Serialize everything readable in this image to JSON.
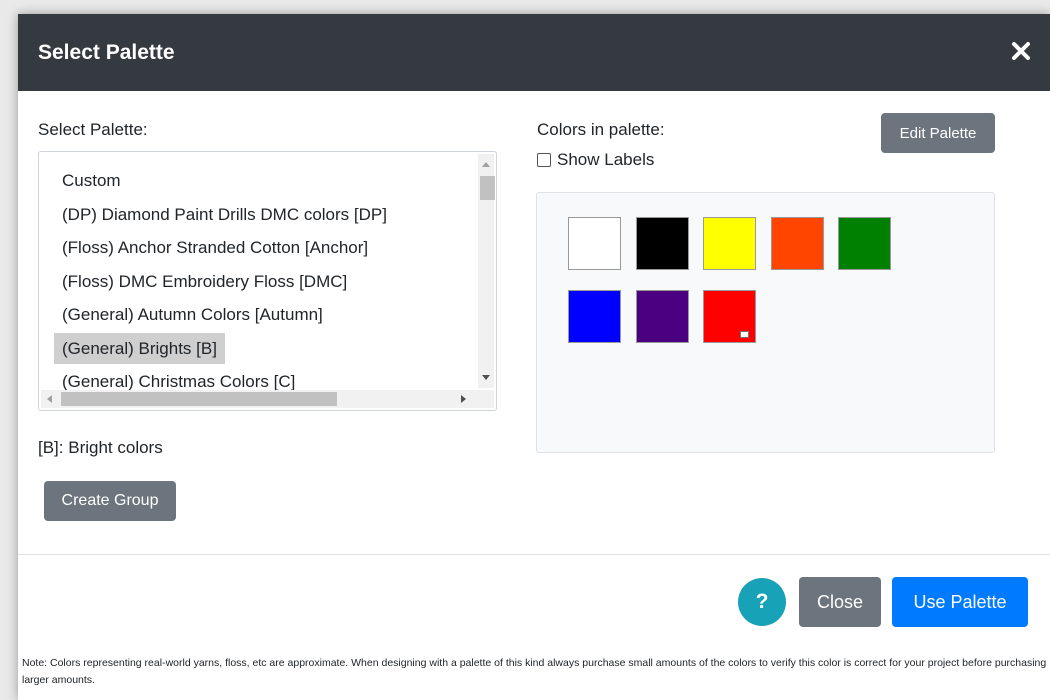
{
  "dialog": {
    "title": "Select Palette",
    "close_icon": "close-x-icon"
  },
  "left": {
    "label": "Select Palette:",
    "palettes": [
      "Custom",
      "(DP) Diamond Paint Drills DMC colors [DP]",
      "(Floss) Anchor Stranded Cotton [Anchor]",
      "(Floss) DMC Embroidery Floss [DMC]",
      "(General) Autumn Colors [Autumn]",
      "(General) Brights [B]",
      "(General) Christmas Colors [C]"
    ],
    "selected": "(General) Brights [B]",
    "description": "[B]: Bright colors",
    "create_group_label": "Create Group"
  },
  "right": {
    "label": "Colors in palette:",
    "show_labels_label": "Show Labels",
    "show_labels_checked": false,
    "edit_palette_label": "Edit Palette",
    "swatches": [
      {
        "color": "#ffffff"
      },
      {
        "color": "#000000"
      },
      {
        "color": "#ffff00"
      },
      {
        "color": "#ff4500"
      },
      {
        "color": "#008000"
      },
      {
        "color": "#0000ff"
      },
      {
        "color": "#4b0082"
      },
      {
        "color": "#ff0000",
        "badge": "small-flag-icon"
      }
    ]
  },
  "footer": {
    "help_label": "?",
    "close_label": "Close",
    "use_palette_label": "Use Palette",
    "note": "Note: Colors representing real-world yarns, floss, etc are approximate. When designing with a palette of this kind always purchase small amounts of the colors to verify this color is correct for your project before purchasing larger amounts."
  },
  "colors": {
    "header_bg": "#343a40",
    "secondary_button": "#6c757d",
    "primary_button": "#007bff",
    "help_button": "#17a2b8"
  }
}
